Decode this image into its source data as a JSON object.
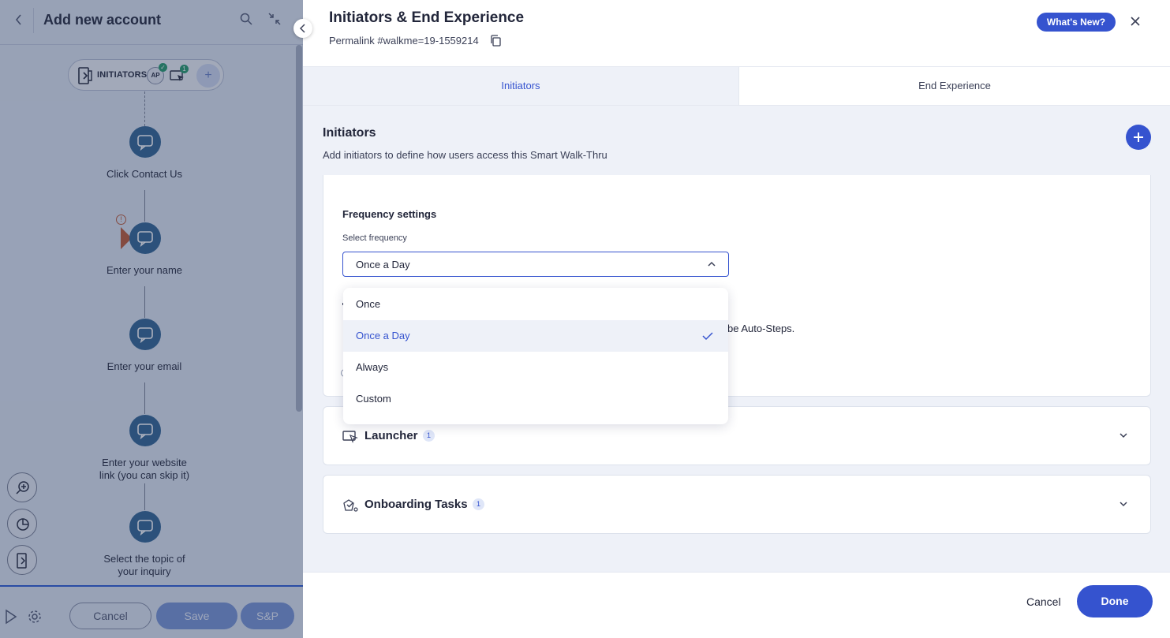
{
  "left_panel": {
    "title": "Add new account",
    "initiators_pill": {
      "label": "INITIATORS",
      "autoplay_badge": "AP",
      "launcher_count": "1"
    },
    "steps": [
      {
        "label": "Click Contact Us"
      },
      {
        "label": "Enter your name"
      },
      {
        "label": "Enter your email"
      },
      {
        "label": "Enter your website link (you can skip it)"
      },
      {
        "label": "Select the topic of your inquiry"
      }
    ],
    "tools": [
      "zoom-in-icon",
      "pie-chart-icon",
      "door-icon"
    ],
    "footer": {
      "cancel_label": "Cancel",
      "save_label": "Save",
      "sp_label": "S&P"
    }
  },
  "modal": {
    "title": "Initiators & End Experience",
    "permalink": "Permalink #walkme=19-1559214",
    "whats_new_label": "What's New?",
    "tabs": [
      {
        "label": "Initiators",
        "active": true
      },
      {
        "label": "End Experience",
        "active": false
      }
    ],
    "section": {
      "title": "Initiators",
      "subtitle": "Add initiators to define how users access this Smart Walk-Thru"
    },
    "frequency": {
      "title": "Frequency settings",
      "select_label": "Select frequency",
      "selected": "Once a Day",
      "options": [
        "Once",
        "Once a Day",
        "Always",
        "Custom"
      ]
    },
    "partially_hidden_text": "be Auto-Steps.",
    "cards": [
      {
        "title": "Launcher",
        "count": "1",
        "icon": "launcher-icon"
      },
      {
        "title": "Onboarding Tasks",
        "count": "1",
        "icon": "onboarding-tasks-icon"
      }
    ],
    "footer": {
      "cancel_label": "Cancel",
      "done_label": "Done"
    }
  },
  "colors": {
    "accent": "#3553cf",
    "step_node": "#3a6b98",
    "warning": "#c0613f",
    "success": "#2e9e72"
  }
}
